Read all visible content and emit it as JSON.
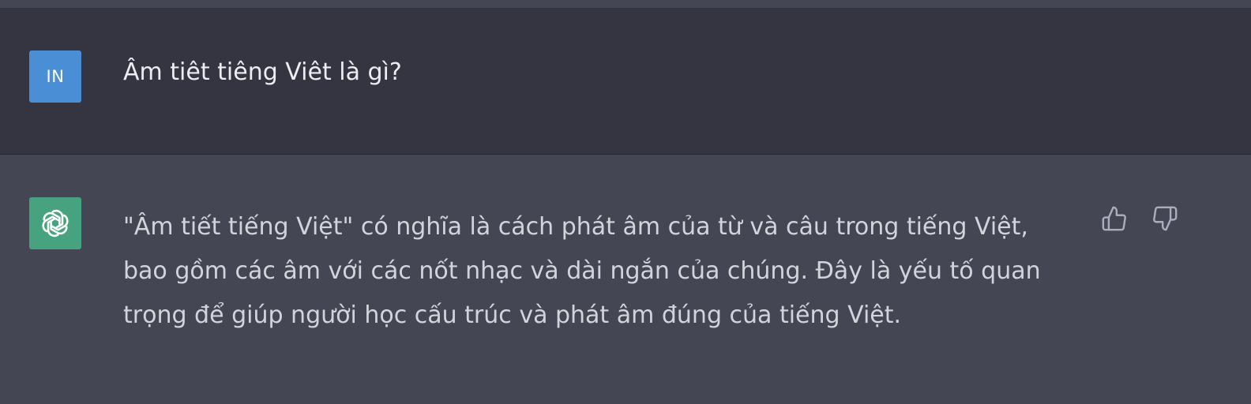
{
  "colors": {
    "user_row_bg": "#343541",
    "assistant_row_bg": "#444654",
    "user_avatar_bg": "#4a8fd6",
    "bot_avatar_bg": "#47a37f",
    "text_user": "#ececf1",
    "text_assistant": "#d1d5db",
    "icon_color": "#acacbe"
  },
  "user_message": {
    "avatar_initials": "IN",
    "text": "Âm tiêt tiêng Viêt là gì?"
  },
  "assistant_message": {
    "avatar_icon": "openai-logo-icon",
    "lines": [
      "\"Âm tiết tiếng Việt\" có nghĩa là cách phát âm của từ và câu trong tiếng Việt,",
      "bao gồm các âm với các nốt nhạc và dài ngắn của chúng. Đây là yếu tố quan",
      "trọng để giúp người học cấu trúc và phát âm đúng của tiếng Việt."
    ],
    "actions": {
      "thumbs_up_icon": "thumbs-up-icon",
      "thumbs_down_icon": "thumbs-down-icon"
    }
  }
}
